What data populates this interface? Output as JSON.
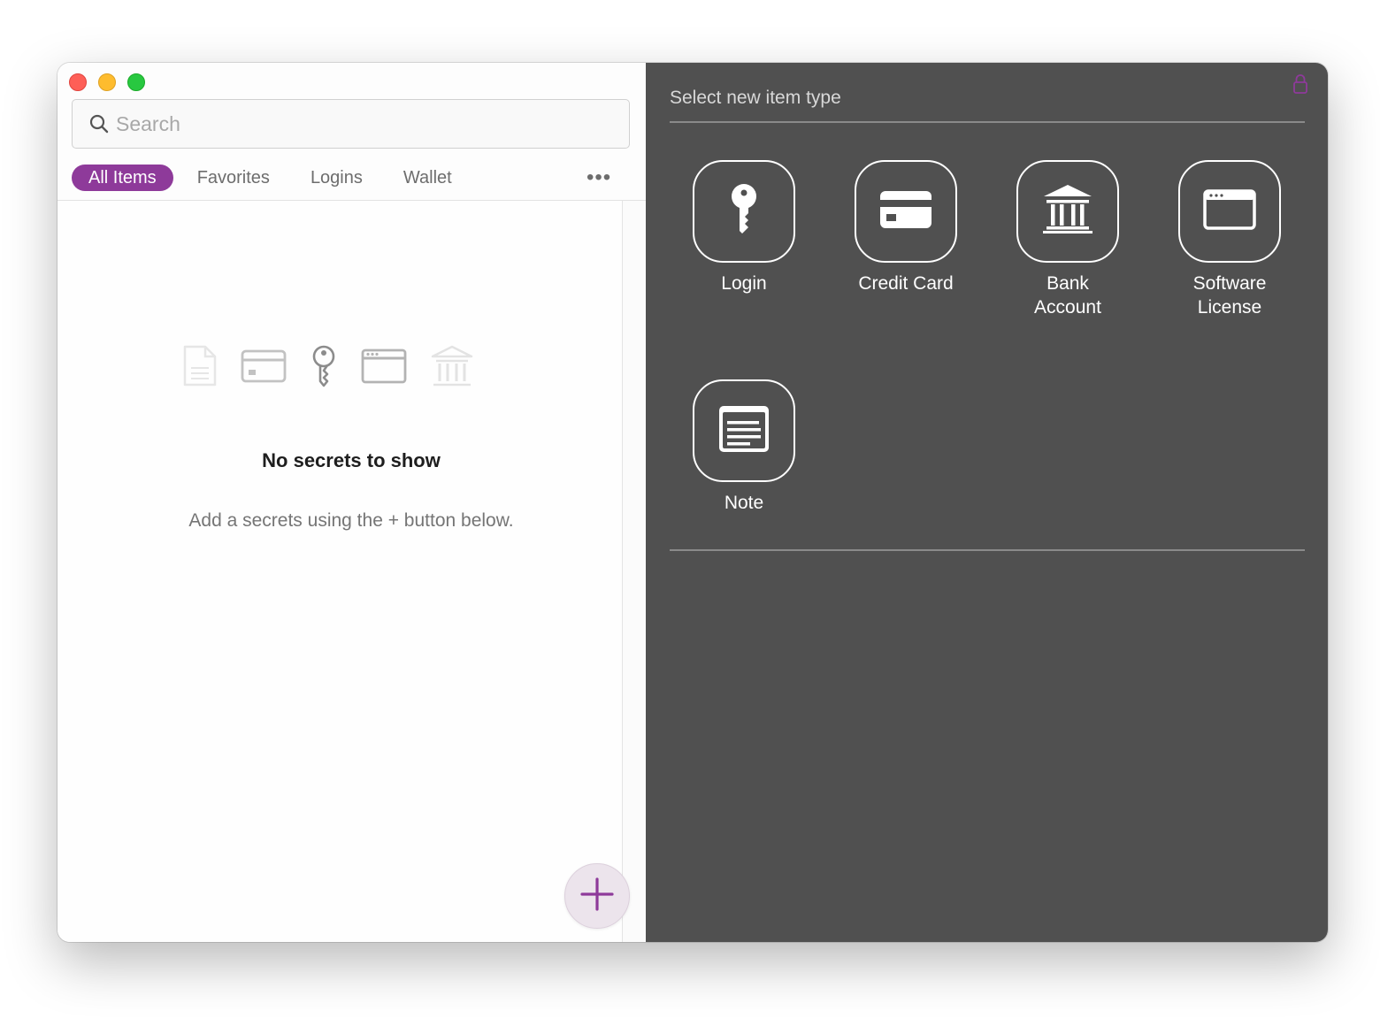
{
  "window": {
    "traffic_lights": [
      "close",
      "minimize",
      "zoom"
    ]
  },
  "search": {
    "placeholder": "Search",
    "value": ""
  },
  "filters": {
    "tabs": [
      {
        "label": "All Items",
        "active": true
      },
      {
        "label": "Favorites",
        "active": false
      },
      {
        "label": "Logins",
        "active": false
      },
      {
        "label": "Wallet",
        "active": false
      }
    ],
    "more_label": "•••"
  },
  "empty_state": {
    "icons": [
      "note-icon",
      "credit-card-icon",
      "key-icon",
      "window-icon",
      "bank-icon"
    ],
    "title": "No secrets to show",
    "subtitle": "Add a secrets using the + button below."
  },
  "add_button": {
    "icon": "plus-icon"
  },
  "new_item": {
    "title": "Select new item type",
    "types": [
      {
        "id": "login",
        "label": "Login",
        "icon": "key-icon"
      },
      {
        "id": "credit-card",
        "label": "Credit Card",
        "icon": "credit-card-icon"
      },
      {
        "id": "bank-account",
        "label": "Bank\nAccount",
        "icon": "bank-icon"
      },
      {
        "id": "software-license",
        "label": "Software\nLicense",
        "icon": "window-icon"
      },
      {
        "id": "note",
        "label": "Note",
        "icon": "note-icon"
      }
    ]
  },
  "colors": {
    "accent": "#8e3a9a",
    "right_pane_bg": "#505050",
    "lock_icon": "#8e3a9a"
  }
}
